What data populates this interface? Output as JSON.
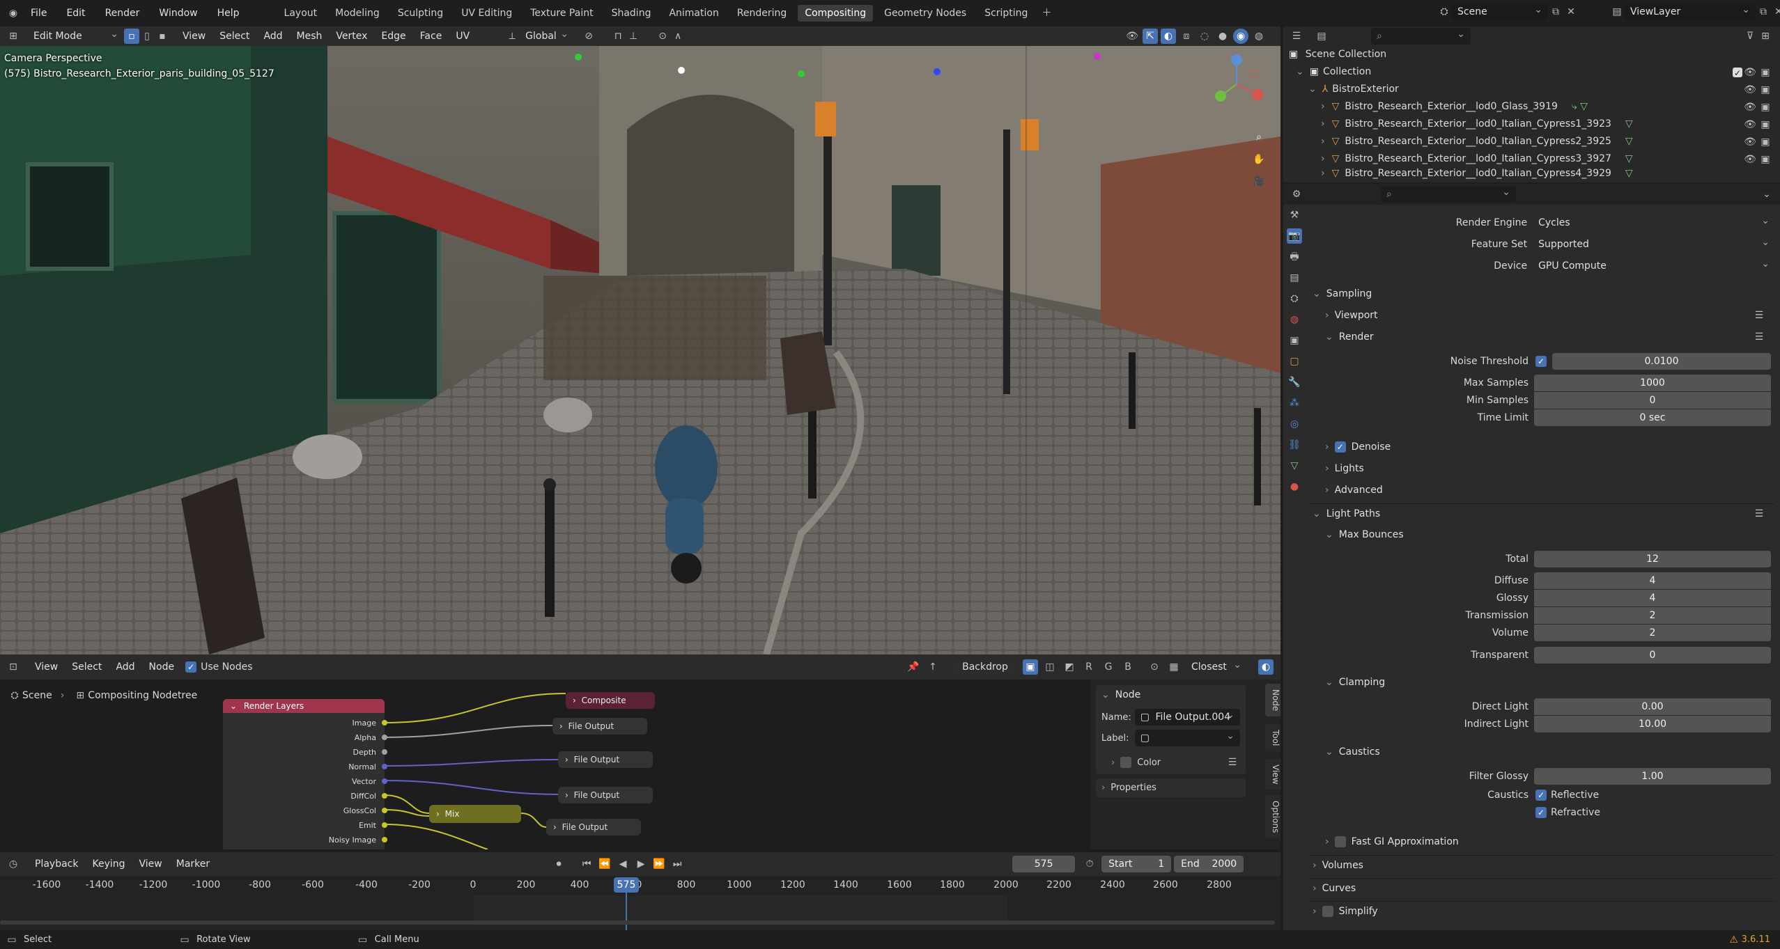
{
  "topbar": {
    "menus": [
      "File",
      "Edit",
      "Render",
      "Window",
      "Help"
    ],
    "workspaces": [
      "Layout",
      "Modeling",
      "Sculpting",
      "UV Editing",
      "Texture Paint",
      "Shading",
      "Animation",
      "Rendering",
      "Compositing",
      "Geometry Nodes",
      "Scripting"
    ],
    "active_workspace": "Compositing",
    "scene": "Scene",
    "view_layer": "ViewLayer"
  },
  "viewport": {
    "mode": "Edit Mode",
    "menus": [
      "View",
      "Select",
      "Add",
      "Mesh",
      "Vertex",
      "Edge",
      "Face",
      "UV"
    ],
    "transform_orientation": "Global",
    "overlay_title": "Camera Perspective",
    "overlay_object": "(575) Bistro_Research_Exterior_paris_building_05_5127"
  },
  "outliner": {
    "search_placeholder": "",
    "root": "Scene Collection",
    "collection": "Collection",
    "group": "BistroExterior",
    "items": [
      "Bistro_Research_Exterior__lod0_Glass_3919",
      "Bistro_Research_Exterior__lod0_Italian_Cypress1_3923",
      "Bistro_Research_Exterior__lod0_Italian_Cypress2_3925",
      "Bistro_Research_Exterior__lod0_Italian_Cypress3_3927",
      "Bistro_Research_Exterior__lod0_Italian_Cypress4_3929"
    ]
  },
  "properties": {
    "render_engine_label": "Render Engine",
    "render_engine": "Cycles",
    "feature_set_label": "Feature Set",
    "feature_set": "Supported",
    "device_label": "Device",
    "device": "GPU Compute",
    "sampling": "Sampling",
    "viewport": "Viewport",
    "render": "Render",
    "noise_threshold_label": "Noise Threshold",
    "noise_threshold": "0.0100",
    "max_samples_label": "Max Samples",
    "max_samples": "1000",
    "min_samples_label": "Min Samples",
    "min_samples": "0",
    "time_limit_label": "Time Limit",
    "time_limit": "0 sec",
    "denoise": "Denoise",
    "lights": "Lights",
    "advanced": "Advanced",
    "light_paths": "Light Paths",
    "max_bounces": "Max Bounces",
    "total_label": "Total",
    "total": "12",
    "diffuse_label": "Diffuse",
    "diffuse": "4",
    "glossy_label": "Glossy",
    "glossy": "4",
    "transmission_label": "Transmission",
    "transmission": "2",
    "volume_label": "Volume",
    "volume": "2",
    "transparent_label": "Transparent",
    "transparent": "0",
    "clamping": "Clamping",
    "direct_light_label": "Direct Light",
    "direct_light": "0.00",
    "indirect_light_label": "Indirect Light",
    "indirect_light": "10.00",
    "caustics_section": "Caustics",
    "filter_glossy_label": "Filter Glossy",
    "filter_glossy": "1.00",
    "caustics_label": "Caustics",
    "reflective": "Reflective",
    "refractive": "Refractive",
    "fast_gi": "Fast GI Approximation",
    "volumes": "Volumes",
    "curves": "Curves",
    "simplify": "Simplify"
  },
  "node_editor": {
    "menus": [
      "View",
      "Select",
      "Add",
      "Node"
    ],
    "use_nodes": "Use Nodes",
    "backdrop": "Backdrop",
    "closest": "Closest",
    "breadcrumb_scene": "Scene",
    "breadcrumb_tree": "Compositing Nodetree",
    "render_layers": "Render Layers",
    "sockets": [
      "Image",
      "Alpha",
      "Depth",
      "Normal",
      "Vector",
      "DiffCol",
      "GlossCol",
      "Emit",
      "Noisy Image"
    ],
    "composite": "Composite",
    "file_output": "File Output",
    "mix": "Mix",
    "sidebar": {
      "node_title": "Node",
      "name_label": "Name:",
      "name_value": "File Output.004",
      "label_label": "Label:",
      "label_value": "",
      "color": "Color",
      "properties": "Properties",
      "tabs": [
        "Node",
        "Tool",
        "View",
        "Options"
      ]
    }
  },
  "timeline": {
    "menus": [
      "Playback",
      "Keying",
      "View",
      "Marker"
    ],
    "current_frame": "575",
    "start_label": "Start",
    "start": "1",
    "end_label": "End",
    "end": "2000",
    "ticks": [
      "-1600",
      "-1400",
      "-1200",
      "-1000",
      "-800",
      "-600",
      "-400",
      "-200",
      "0",
      "200",
      "400",
      "600",
      "800",
      "1000",
      "1200",
      "1400",
      "1600",
      "1800",
      "2000",
      "2200",
      "2400",
      "2600",
      "2800"
    ]
  },
  "statusbar": {
    "select": "Select",
    "rotate": "Rotate View",
    "call_menu": "Call Menu",
    "version": "3.6.11"
  },
  "colors": {
    "accent": "#4772b3",
    "active_tab": "#3d3d3d",
    "render_layers_header": "#a0354e",
    "composite_header": "#5a2232",
    "mix_node": "#6f6f22",
    "socket_yellow": "#c7c729",
    "socket_gray": "#a1a1a1",
    "socket_blue": "#6363c7"
  }
}
